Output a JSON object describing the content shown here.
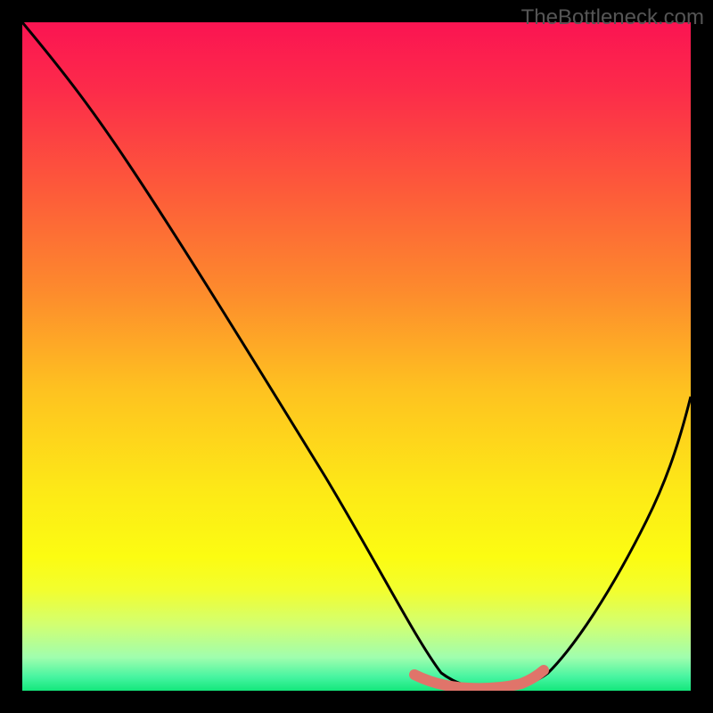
{
  "watermark": "TheBottleneck.com",
  "chart_data": {
    "type": "line",
    "title": "",
    "xlabel": "",
    "ylabel": "",
    "xlim": [
      0,
      100
    ],
    "ylim": [
      0,
      100
    ],
    "series": [
      {
        "name": "bottleneck-curve",
        "x": [
          0,
          5,
          10,
          15,
          20,
          25,
          30,
          35,
          40,
          45,
          50,
          55,
          58,
          61,
          63,
          65,
          68,
          70,
          73,
          75,
          78,
          82,
          86,
          90,
          95,
          100
        ],
        "y": [
          100,
          92,
          85,
          78,
          70,
          62,
          54,
          46,
          38,
          30,
          22,
          14,
          8,
          4,
          2,
          1,
          0.5,
          0.5,
          1,
          2,
          5,
          10,
          18,
          27,
          38,
          50
        ],
        "color": "#000000"
      },
      {
        "name": "optimal-band",
        "x": [
          58,
          60,
          62,
          64,
          66,
          68,
          70,
          72,
          74
        ],
        "y": [
          2.5,
          1.5,
          1.0,
          0.7,
          0.6,
          0.6,
          0.7,
          1.0,
          2.0
        ],
        "color": "#e0746a"
      }
    ],
    "gradient_stops": [
      {
        "pos": 0,
        "color": "#fb1452"
      },
      {
        "pos": 10,
        "color": "#fc2b4a"
      },
      {
        "pos": 25,
        "color": "#fd5a3a"
      },
      {
        "pos": 40,
        "color": "#fd8a2d"
      },
      {
        "pos": 55,
        "color": "#fec220"
      },
      {
        "pos": 70,
        "color": "#fde917"
      },
      {
        "pos": 80,
        "color": "#fcfc12"
      },
      {
        "pos": 85,
        "color": "#f2fe2f"
      },
      {
        "pos": 90,
        "color": "#d3ff70"
      },
      {
        "pos": 95,
        "color": "#a0feae"
      },
      {
        "pos": 98,
        "color": "#45f4a0"
      },
      {
        "pos": 100,
        "color": "#14e77b"
      }
    ]
  }
}
